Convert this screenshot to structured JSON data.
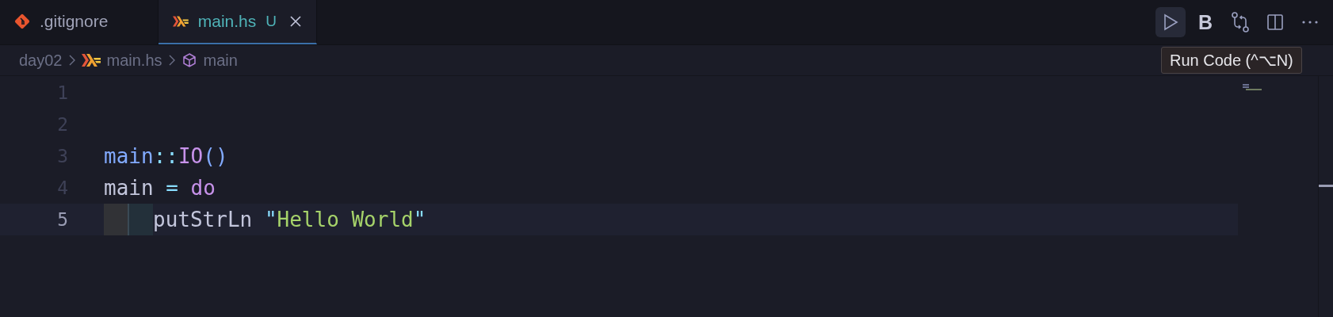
{
  "tabs": [
    {
      "label": ".gitignore",
      "kind": "git",
      "selected": false
    },
    {
      "label": "main.hs",
      "kind": "haskell",
      "selected": true,
      "badge": "U"
    }
  ],
  "toolbar": [
    {
      "kind": "run",
      "hovered": true
    },
    {
      "kind": "bold",
      "label": "B",
      "hovered": false
    },
    {
      "kind": "compare",
      "hovered": false
    },
    {
      "kind": "split",
      "hovered": false
    },
    {
      "kind": "more",
      "hovered": false
    }
  ],
  "tooltip": "Run Code (^⌥N)",
  "breadcrumbs": [
    {
      "label": "day02",
      "kind": "folder"
    },
    {
      "label": "main.hs",
      "kind": "haskell"
    },
    {
      "label": "main",
      "kind": "symbol"
    }
  ],
  "editor": {
    "lines": [
      {
        "number": "1",
        "current": false,
        "indented": false
      },
      {
        "number": "2",
        "current": false,
        "indented": false
      },
      {
        "number": "3",
        "current": false,
        "indented": false,
        "tokens": [
          {
            "text": "main",
            "kind": "function"
          },
          {
            "text": "::",
            "kind": "operator"
          },
          {
            "text": "IO",
            "kind": "type"
          },
          {
            "text": "()",
            "kind": "function"
          }
        ]
      },
      {
        "number": "4",
        "current": false,
        "indented": false,
        "tokens": [
          {
            "text": "main ",
            "kind": "plain"
          },
          {
            "text": "= ",
            "kind": "operator"
          },
          {
            "text": "do",
            "kind": "keyword"
          }
        ]
      },
      {
        "number": "5",
        "current": true,
        "indented": true,
        "tokens": [
          {
            "text": "putStrLn ",
            "kind": "plain"
          },
          {
            "text": "\"",
            "kind": "operator"
          },
          {
            "text": "Hello World",
            "kind": "string"
          },
          {
            "text": "\"",
            "kind": "operator"
          }
        ]
      }
    ]
  }
}
